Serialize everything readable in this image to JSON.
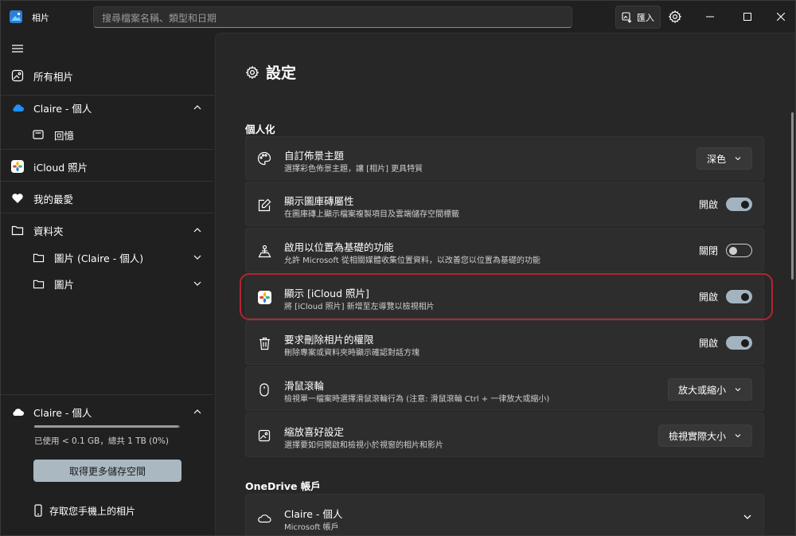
{
  "app": {
    "title": "相片"
  },
  "search": {
    "placeholder": "搜尋檔案名稱、類型和日期"
  },
  "toolbar": {
    "import_label": "匯入"
  },
  "sidebar": {
    "items": [
      {
        "label": "所有相片",
        "icon": "photo-icon"
      },
      {
        "label": "Claire - 個人",
        "icon": "onedrive-cloud-icon"
      },
      {
        "label": "回憶",
        "icon": "memories-icon"
      },
      {
        "label": "iCloud 照片",
        "icon": "icloud-photos-icon"
      },
      {
        "label": "我的最愛",
        "icon": "heart-icon"
      },
      {
        "label": "資料夾",
        "icon": "folder-icon"
      },
      {
        "label": "圖片 (Claire - 個人)",
        "icon": "folder-icon"
      },
      {
        "label": "圖片",
        "icon": "folder-icon"
      }
    ],
    "storage": {
      "account": "Claire - 個人",
      "usage": "已使用 < 0.1 GB，總共 1 TB (0%)",
      "usage_fraction": 0.99,
      "more_storage": "取得更多儲存空間"
    },
    "phone_link": "存取您手機上的相片"
  },
  "settings": {
    "title": "設定",
    "personalization": {
      "heading": "個人化",
      "rows": [
        {
          "title": "自訂佈景主題",
          "desc": "選擇彩色佈景主題，讓 [相片] 更具特質",
          "control": "dropdown",
          "value": "深色"
        },
        {
          "title": "顯示圖庫磚屬性",
          "desc": "在圖庫磚上顯示檔案複製項目及雲端儲存空間標籤",
          "control": "toggle",
          "state": "開啟",
          "on": true
        },
        {
          "title": "啟用以位置為基礎的功能",
          "desc": "允許 Microsoft 從相關媒體收集位置資料，以改善您以位置為基礎的功能",
          "control": "toggle",
          "state": "關閉",
          "on": false
        },
        {
          "title": "顯示 [iCloud 照片]",
          "desc": "將 [iCloud 照片] 新增至左導覽以檢視相片",
          "control": "toggle",
          "state": "開啟",
          "on": true
        },
        {
          "title": "要求刪除相片的權限",
          "desc": "刪除專案或資料夾時顯示確認對話方塊",
          "control": "toggle",
          "state": "開啟",
          "on": true
        },
        {
          "title": "滑鼠滾輪",
          "desc": "檢視單一檔案時選擇滑鼠滾輪行為 (注意: 滑鼠滾輪 Ctrl + 一律放大或縮小)",
          "control": "dropdown",
          "value": "放大或縮小"
        },
        {
          "title": "縮放喜好設定",
          "desc": "選擇要如何開啟和檢視小於視窗的相片和影片",
          "control": "dropdown",
          "value": "檢視實際大小"
        }
      ]
    },
    "onedrive": {
      "heading": "OneDrive 帳戶",
      "account_name": "Claire - 個人",
      "account_type": "Microsoft 帳戶"
    }
  },
  "colors": {
    "accent": "#a3b4c0",
    "highlight": "#b3262f",
    "background": "#202020",
    "card": "#2d2d2d"
  }
}
